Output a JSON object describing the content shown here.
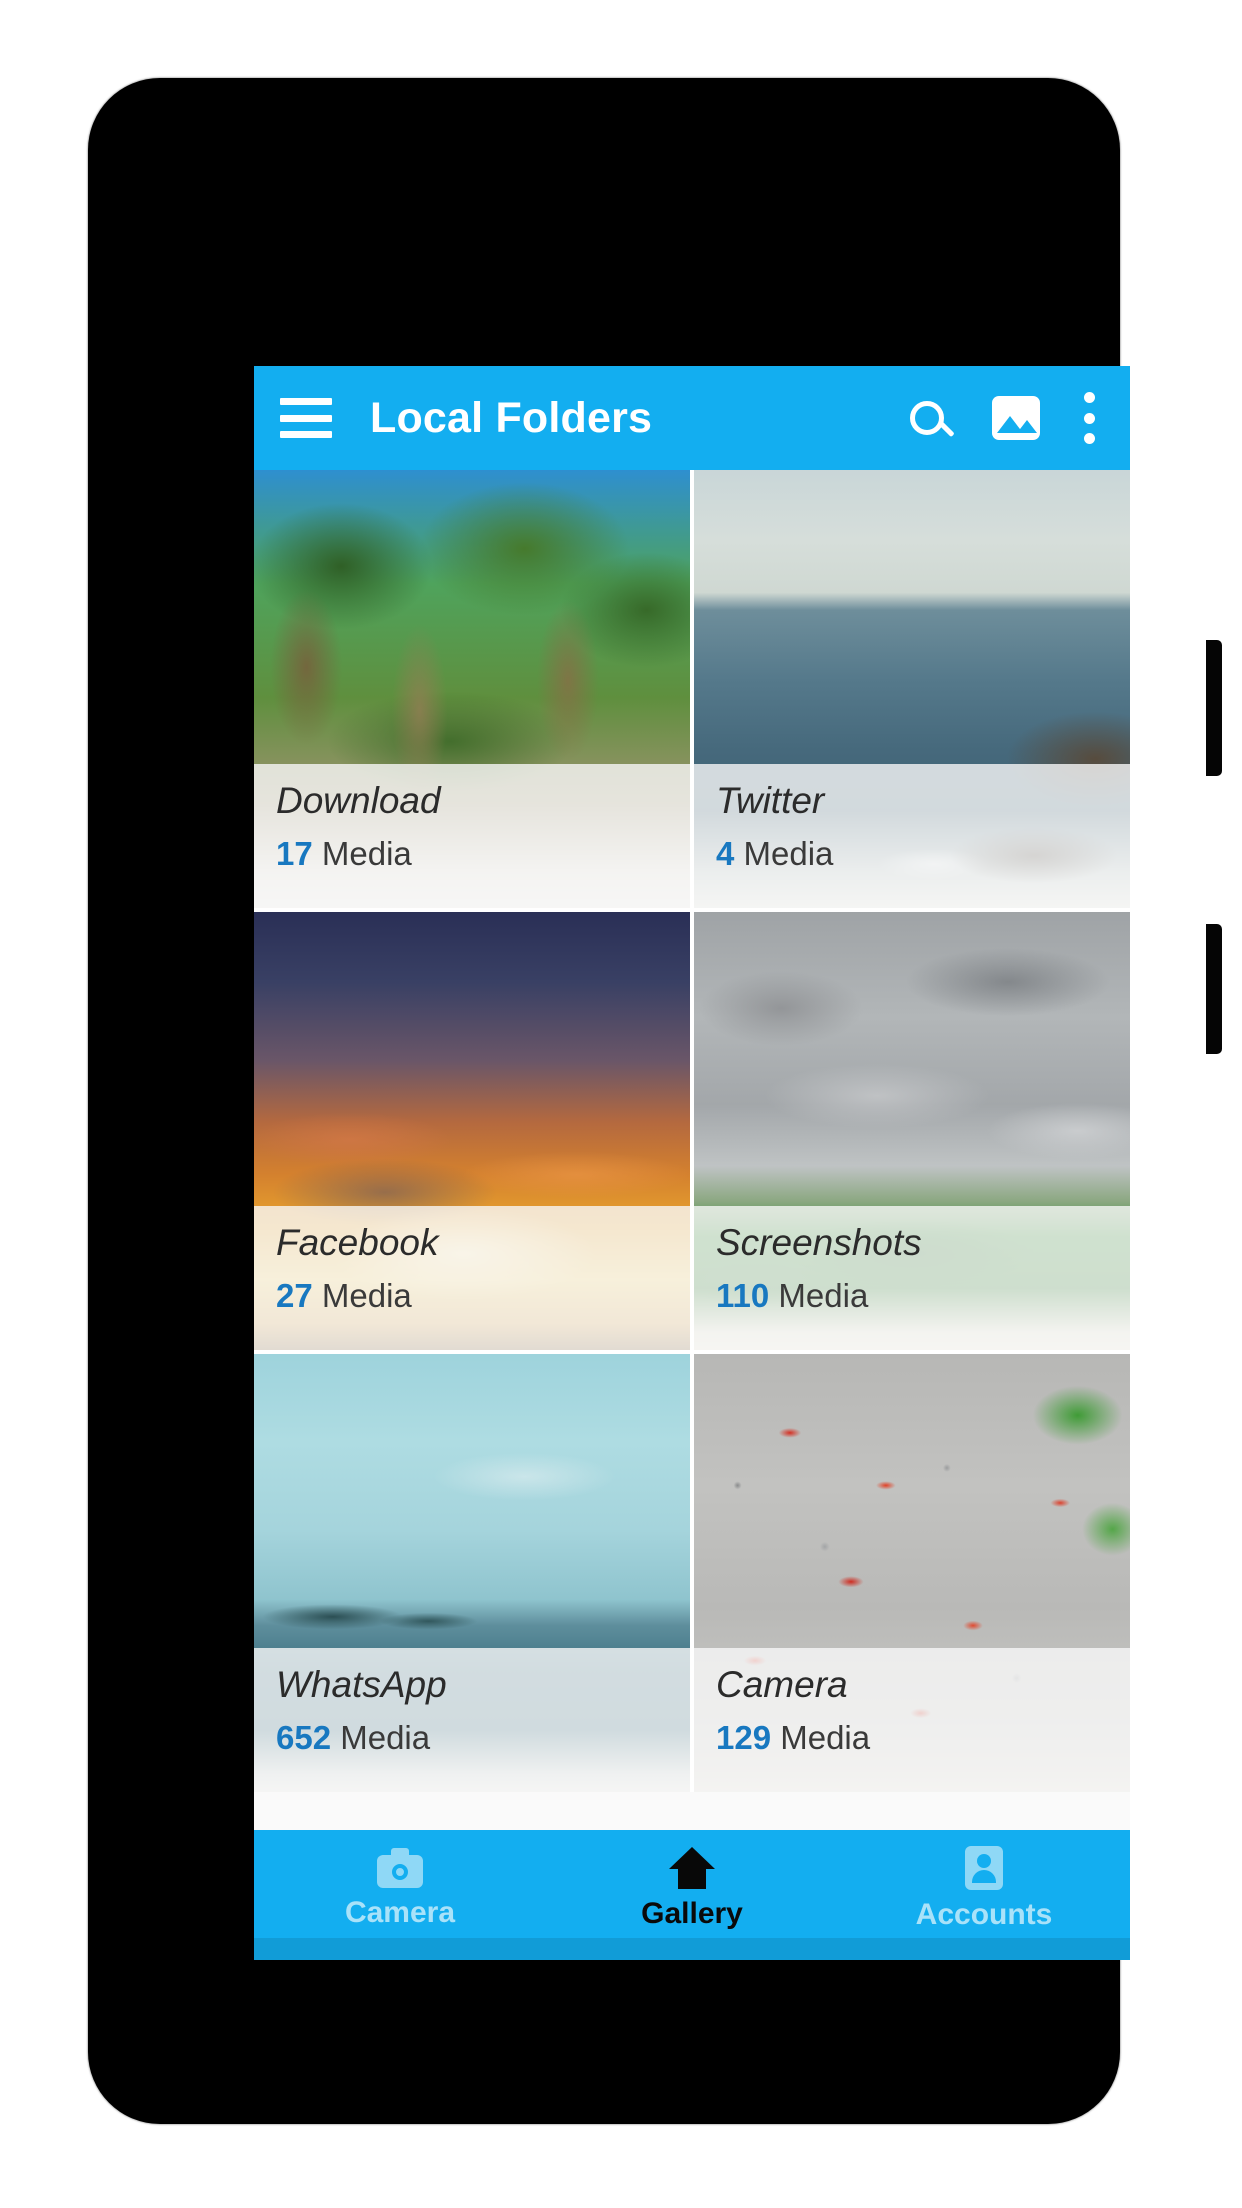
{
  "app_bar": {
    "title": "Local Folders",
    "menu_icon": "hamburger-menu-icon",
    "search_icon": "search-icon",
    "gallery_icon": "image-icon",
    "overflow_icon": "more-vertical-icon",
    "background_color": "#13AEF0",
    "title_color": "#FFFFFF"
  },
  "folders": [
    {
      "name": "Download",
      "count": "17",
      "media_label": "Media",
      "thumbnail": "forest-trees-blue-sky"
    },
    {
      "name": "Twitter",
      "count": "4",
      "media_label": "Media",
      "thumbnail": "ocean-rocky-coast"
    },
    {
      "name": "Facebook",
      "count": "27",
      "media_label": "Media",
      "thumbnail": "orange-sunset-sky"
    },
    {
      "name": "Screenshots",
      "count": "110",
      "media_label": "Media",
      "thumbnail": "gray-storm-clouds-treeline"
    },
    {
      "name": "WhatsApp",
      "count": "652",
      "media_label": "Media",
      "thumbnail": "teal-sea-distant-islands"
    },
    {
      "name": "Camera",
      "count": "129",
      "media_label": "Media",
      "thumbnail": "gray-gravel-red-petals"
    }
  ],
  "bottom_nav": {
    "items": [
      {
        "label": "Camera",
        "icon": "camera-icon",
        "active": false
      },
      {
        "label": "Gallery",
        "icon": "home-icon",
        "active": true
      },
      {
        "label": "Accounts",
        "icon": "contact-icon",
        "active": false
      }
    ],
    "background_color": "#13AEF0",
    "active_color": "#0A0A0A",
    "inactive_color": "#A9E2F9"
  },
  "theme": {
    "accent": "#13AEF0",
    "count_number_color": "#1878C0",
    "folder_label_color": "#2B2B2B",
    "device_body_color": "#000000"
  }
}
